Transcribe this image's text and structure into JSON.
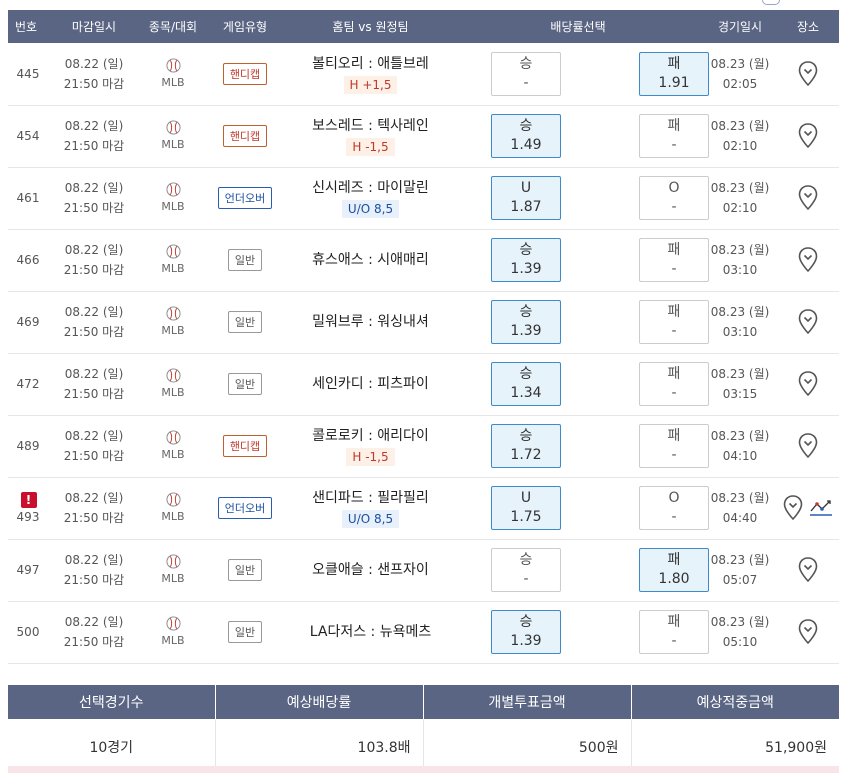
{
  "header": [
    "번호",
    "마감일시",
    "종목/대회",
    "게임유형",
    "홈팀 vs 원정팀",
    "배당률선택",
    "경기일시",
    "장소"
  ],
  "games": [
    {
      "num": "445",
      "alert": false,
      "deadline_date": "08.22 (일)",
      "deadline_time": "21:50 마감",
      "sport": "MLB",
      "type": "핸디캡",
      "type_class": "handicap",
      "match": "볼티오리 : 애틀브레",
      "tag": "H +1,5",
      "tag_class": "h",
      "win_label": "승",
      "win_odd": "-",
      "win_sel": false,
      "lose_label": "패",
      "lose_odd": "1.91",
      "lose_sel": true,
      "game_date": "08.23 (월)",
      "game_time": "02:05",
      "chart": false
    },
    {
      "num": "454",
      "alert": false,
      "deadline_date": "08.22 (일)",
      "deadline_time": "21:50 마감",
      "sport": "MLB",
      "type": "핸디캡",
      "type_class": "handicap",
      "match": "보스레드 : 텍사레인",
      "tag": "H -1,5",
      "tag_class": "h",
      "win_label": "승",
      "win_odd": "1.49",
      "win_sel": true,
      "lose_label": "패",
      "lose_odd": "-",
      "lose_sel": false,
      "game_date": "08.23 (월)",
      "game_time": "02:10",
      "chart": false
    },
    {
      "num": "461",
      "alert": false,
      "deadline_date": "08.22 (일)",
      "deadline_time": "21:50 마감",
      "sport": "MLB",
      "type": "언더오버",
      "type_class": "uo",
      "match": "신시레즈 : 마이말린",
      "tag": "U/O 8,5",
      "tag_class": "u",
      "win_label": "U",
      "win_odd": "1.87",
      "win_sel": true,
      "lose_label": "O",
      "lose_odd": "-",
      "lose_sel": false,
      "game_date": "08.23 (월)",
      "game_time": "02:10",
      "chart": false
    },
    {
      "num": "466",
      "alert": false,
      "deadline_date": "08.22 (일)",
      "deadline_time": "21:50 마감",
      "sport": "MLB",
      "type": "일반",
      "type_class": "general",
      "match": "휴스애스 : 시애매리",
      "tag": "",
      "tag_class": "",
      "win_label": "승",
      "win_odd": "1.39",
      "win_sel": true,
      "lose_label": "패",
      "lose_odd": "-",
      "lose_sel": false,
      "game_date": "08.23 (월)",
      "game_time": "03:10",
      "chart": false
    },
    {
      "num": "469",
      "alert": false,
      "deadline_date": "08.22 (일)",
      "deadline_time": "21:50 마감",
      "sport": "MLB",
      "type": "일반",
      "type_class": "general",
      "match": "밀워브루 : 워싱내셔",
      "tag": "",
      "tag_class": "",
      "win_label": "승",
      "win_odd": "1.39",
      "win_sel": true,
      "lose_label": "패",
      "lose_odd": "-",
      "lose_sel": false,
      "game_date": "08.23 (월)",
      "game_time": "03:10",
      "chart": false
    },
    {
      "num": "472",
      "alert": false,
      "deadline_date": "08.22 (일)",
      "deadline_time": "21:50 마감",
      "sport": "MLB",
      "type": "일반",
      "type_class": "general",
      "match": "세인카디 : 피츠파이",
      "tag": "",
      "tag_class": "",
      "win_label": "승",
      "win_odd": "1.34",
      "win_sel": true,
      "lose_label": "패",
      "lose_odd": "-",
      "lose_sel": false,
      "game_date": "08.23 (월)",
      "game_time": "03:15",
      "chart": false
    },
    {
      "num": "489",
      "alert": false,
      "deadline_date": "08.22 (일)",
      "deadline_time": "21:50 마감",
      "sport": "MLB",
      "type": "핸디캡",
      "type_class": "handicap",
      "match": "콜로로키 : 애리다이",
      "tag": "H -1,5",
      "tag_class": "h",
      "win_label": "승",
      "win_odd": "1.72",
      "win_sel": true,
      "lose_label": "패",
      "lose_odd": "-",
      "lose_sel": false,
      "game_date": "08.23 (월)",
      "game_time": "04:10",
      "chart": false
    },
    {
      "num": "493",
      "alert": true,
      "alert_mark": "!",
      "deadline_date": "08.22 (일)",
      "deadline_time": "21:50 마감",
      "sport": "MLB",
      "type": "언더오버",
      "type_class": "uo",
      "match": "샌디파드 : 필라필리",
      "tag": "U/O 8,5",
      "tag_class": "u",
      "win_label": "U",
      "win_odd": "1.75",
      "win_sel": true,
      "lose_label": "O",
      "lose_odd": "-",
      "lose_sel": false,
      "game_date": "08.23 (월)",
      "game_time": "04:40",
      "chart": true
    },
    {
      "num": "497",
      "alert": false,
      "deadline_date": "08.22 (일)",
      "deadline_time": "21:50 마감",
      "sport": "MLB",
      "type": "일반",
      "type_class": "general",
      "match": "오클애슬 : 샌프자이",
      "tag": "",
      "tag_class": "",
      "win_label": "승",
      "win_odd": "-",
      "win_sel": false,
      "lose_label": "패",
      "lose_odd": "1.80",
      "lose_sel": true,
      "game_date": "08.23 (월)",
      "game_time": "05:07",
      "chart": false
    },
    {
      "num": "500",
      "alert": false,
      "deadline_date": "08.22 (일)",
      "deadline_time": "21:50 마감",
      "sport": "MLB",
      "type": "일반",
      "type_class": "general",
      "match": "LA다저스 : 뉴욕메츠",
      "tag": "",
      "tag_class": "",
      "win_label": "승",
      "win_odd": "1.39",
      "win_sel": true,
      "lose_label": "패",
      "lose_odd": "-",
      "lose_sel": false,
      "game_date": "08.23 (월)",
      "game_time": "05:10",
      "chart": false
    }
  ],
  "summary": {
    "headers": [
      "선택경기수",
      "예상배당률",
      "개별투표금액",
      "예상적중금액"
    ],
    "values": [
      "10경기",
      "103.8배",
      "500원",
      "51,900원"
    ]
  },
  "colors": {
    "header_bg": "#5a6584",
    "selected_bg": "#e6f3fb",
    "selected_border": "#3f8bc9",
    "alert": "#c8102e"
  },
  "icons": {
    "sport": "baseball-icon",
    "venue": "map-pin-icon",
    "stats": "line-chart-icon"
  }
}
